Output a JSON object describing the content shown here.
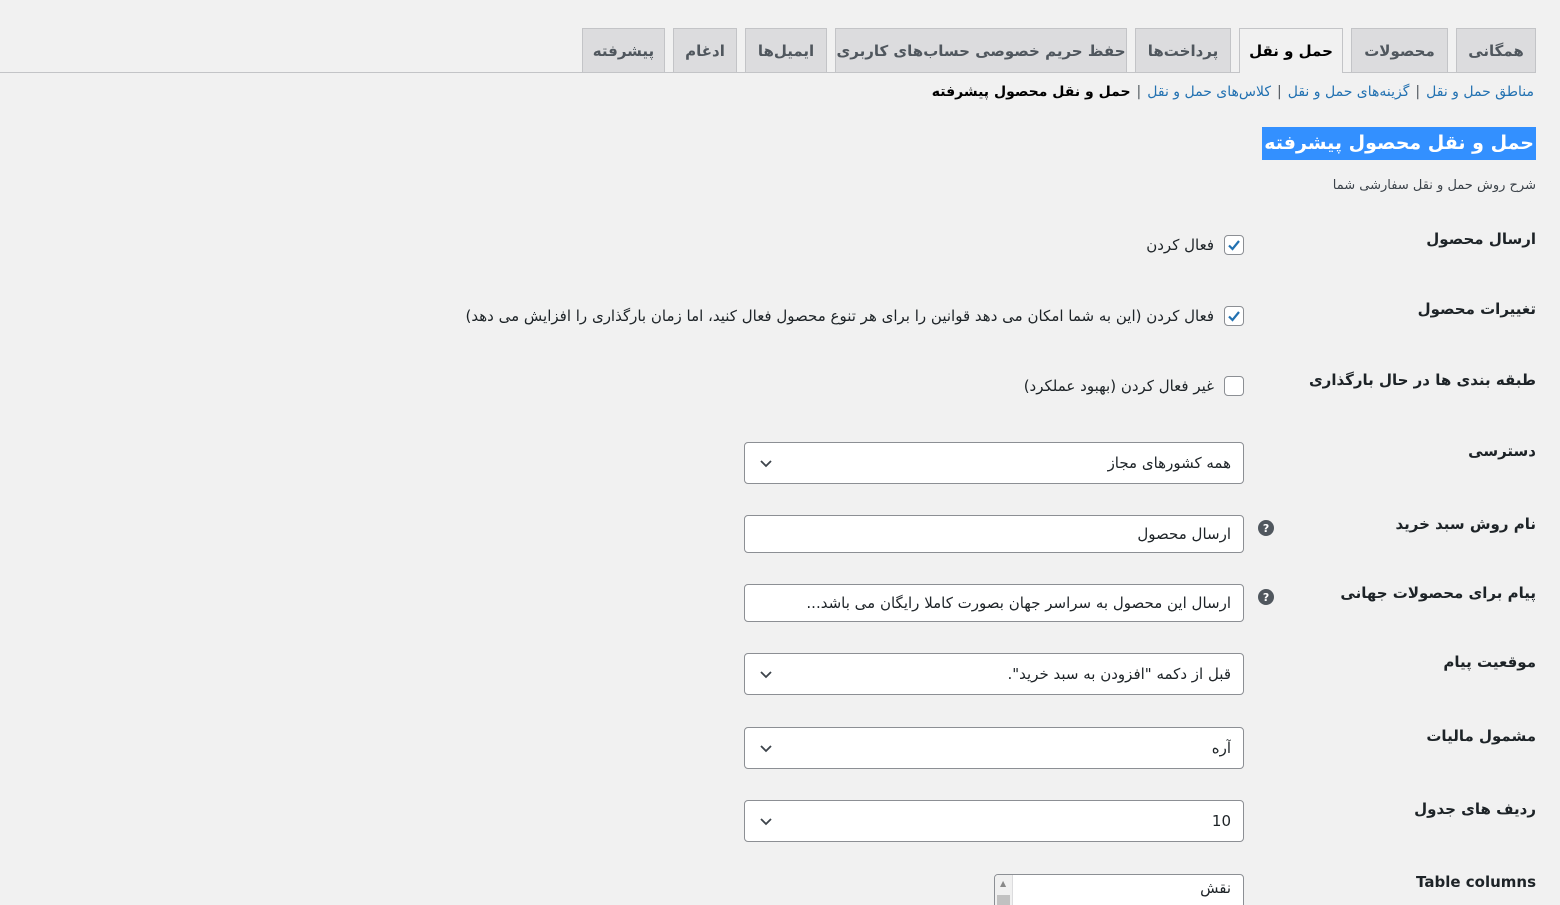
{
  "tabs": [
    {
      "label": "همگانی",
      "active": false
    },
    {
      "label": "محصولات",
      "active": false
    },
    {
      "label": "حمل و نقل",
      "active": true
    },
    {
      "label": "پرداخت‌ها",
      "active": false
    },
    {
      "label": "حفظ حریم خصوصی حساب‌های کاربری",
      "active": false
    },
    {
      "label": "ایمیل‌ها",
      "active": false
    },
    {
      "label": "ادغام",
      "active": false
    },
    {
      "label": "پیشرفته",
      "active": false
    }
  ],
  "subnav": {
    "links": [
      "مناطق حمل و نقل",
      "گزینه‌های حمل و نقل",
      "کلاس‌های حمل و نقل"
    ],
    "separator": "|",
    "current": "حمل و نقل محصول پیشرفته"
  },
  "section": {
    "title": "حمل و نقل محصول پیشرفته",
    "description": "شرح روش حمل و نقل سفارشی شما"
  },
  "rows": {
    "ship_product": {
      "label": "ارسال محصول",
      "option": "فعال کردن",
      "checked": true
    },
    "variations": {
      "label": "تغییرات محصول",
      "option": "فعال کردن (این به شما امکان می دهد قوانین را برای هر تنوع محصول فعال کنید، اما زمان بارگذاری را افزایش می دهد)",
      "checked": true
    },
    "categories_loading": {
      "label": "طبقه بندی ها در حال بارگذاری",
      "option": "غیر فعال کردن (بهبود عملکرد)",
      "checked": false
    },
    "access": {
      "label": "دسترسی",
      "value": "همه کشورهای مجاز"
    },
    "cart_method_name": {
      "label": "نام روش سبد خرید",
      "value": "ارسال محصول"
    },
    "global_message": {
      "label": "پیام برای محصولات جهانی",
      "value": "ارسال این محصول به سراسر جهان بصورت کاملا رایگان می باشد..."
    },
    "message_position": {
      "label": "موقعیت پیام",
      "value": "قبل از دکمه \"افزودن به سبد خرید\"."
    },
    "taxable": {
      "label": "مشمول مالیات",
      "value": "آره"
    },
    "table_rows": {
      "label": "ردیف های جدول",
      "value": "10"
    },
    "table_columns": {
      "label": "Table columns",
      "items": [
        "نقش"
      ]
    }
  },
  "colors": {
    "accent": "#2271b1",
    "highlight": "#3390ff",
    "background": "#f1f1f1"
  },
  "icons": {
    "checkmark": "check-icon",
    "dropdown": "chevron-down-icon",
    "help": "help-icon"
  }
}
